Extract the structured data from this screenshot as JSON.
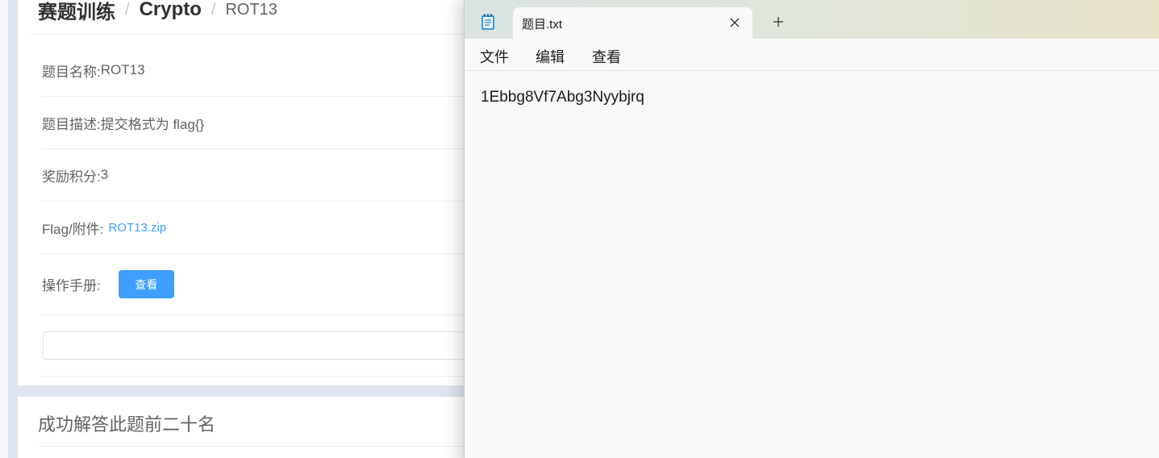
{
  "breadcrumb": {
    "training": "赛题训练",
    "separator": "/",
    "category": "Crypto",
    "current": "ROT13"
  },
  "challenge": {
    "name_label": "题目名称:",
    "name_value": "ROT13",
    "desc_label": "题目描述:",
    "desc_value": "提交格式为 flag{}",
    "points_label": "奖励积分:",
    "points_value": "3",
    "attachment_label": "Flag/附件:",
    "attachment_link": "ROT13.zip",
    "manual_label": "操作手册:",
    "manual_button": "查看"
  },
  "ranking": {
    "title": "成功解答此题前二十名"
  },
  "notepad": {
    "tab_title": "题目.txt",
    "menu": [
      "文件",
      "编辑",
      "查看"
    ],
    "content": "1Ebbg8Vf7Abg3Nyybjrq"
  },
  "colors": {
    "accent": "#409eff",
    "page_bg": "#dfe5f0"
  }
}
